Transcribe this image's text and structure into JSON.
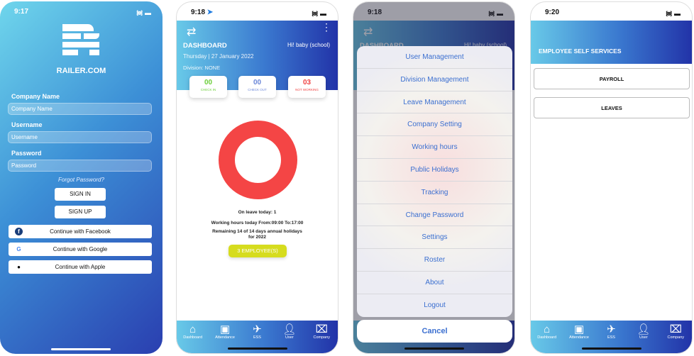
{
  "login": {
    "time": "9:17",
    "brand": "RAILER.COM",
    "company_label": "Company Name",
    "company_placeholder": "Company Name",
    "username_label": "Username",
    "username_placeholder": "Username",
    "password_label": "Password",
    "password_placeholder": "Password",
    "forgot": "Forgot Password?",
    "sign_in": "SIGN IN",
    "sign_up": "SIGN UP",
    "facebook": "Continue with Facebook",
    "google": "Continue with Google",
    "apple": "Continue with Apple"
  },
  "dashboard": {
    "time": "9:18",
    "title": "DASHBOARD",
    "greeting": "Hi! baby (school)",
    "date": "Thursday | 27 January 2022",
    "division": "Division: NONE",
    "cards": [
      {
        "value": "00",
        "label": "CHECK IN",
        "color": "#6ccf3a"
      },
      {
        "value": "00",
        "label": "CHECK OUT",
        "color": "#6a86d8"
      },
      {
        "value": "03",
        "label": "NOT WORKING",
        "color": "#f04444"
      }
    ],
    "on_leave": "On leave today: 1",
    "working_hours": "Working hours today From:09:00 To:17:00",
    "remaining": "Remaining 14 of 14 days annual holidays",
    "remaining_year": "for 2022",
    "employees_button": "3 EMPLOYEE(S)",
    "donut_color": "#f44545"
  },
  "menu": {
    "time": "9:18",
    "items": [
      "User Management",
      "Division Management",
      "Leave Management",
      "Company Setting",
      "Working hours",
      "Public Holidays",
      "Tracking",
      "Change Password",
      "Settings",
      "Roster",
      "About",
      "Logout"
    ],
    "cancel": "Cancel"
  },
  "ess": {
    "time": "9:20",
    "title": "EMPLOYEE SELF SERVICES",
    "buttons": [
      "PAYROLL",
      "LEAVES"
    ]
  },
  "nav": [
    {
      "label": "Dashboard",
      "icon": "home-icon"
    },
    {
      "label": "Attendance",
      "icon": "attendance-icon"
    },
    {
      "label": "ESS",
      "icon": "plane-ticket-icon"
    },
    {
      "label": "User",
      "icon": "user-icon"
    },
    {
      "label": "Company",
      "icon": "company-icon"
    }
  ]
}
